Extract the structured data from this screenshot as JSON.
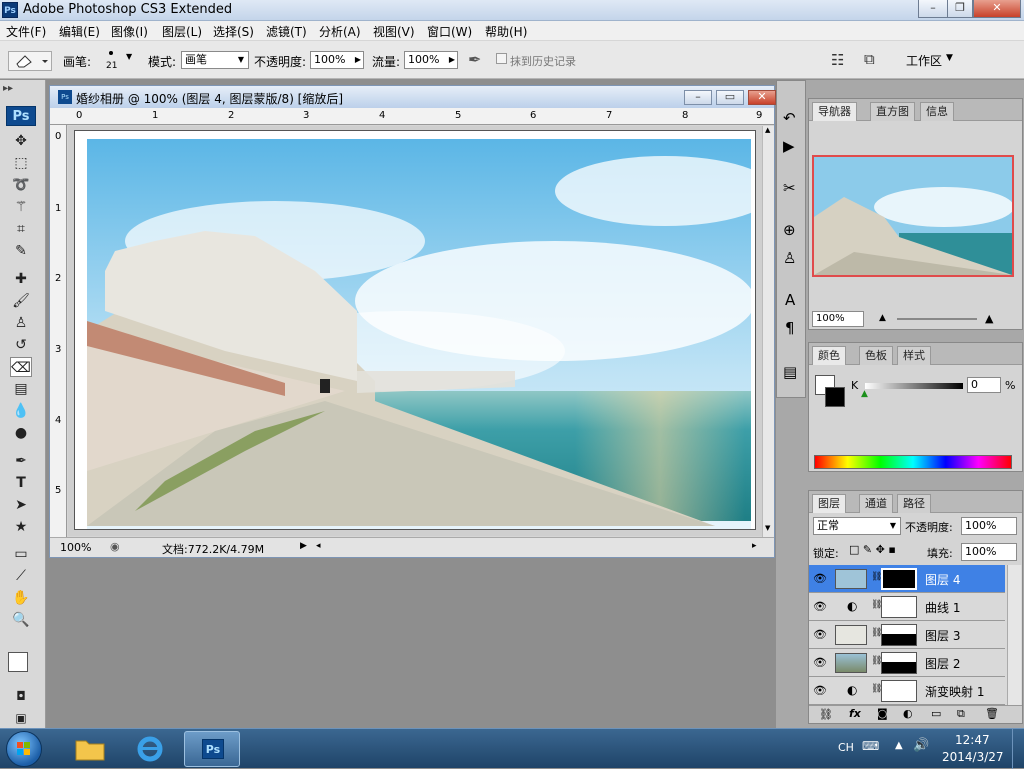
{
  "app": {
    "title": "Adobe Photoshop CS3 Extended",
    "logo": "Ps"
  },
  "window_controls": {
    "minimize": "–",
    "restore": "❐",
    "close": "✕"
  },
  "menu": [
    "文件(F)",
    "编辑(E)",
    "图像(I)",
    "图层(L)",
    "选择(S)",
    "滤镜(T)",
    "分析(A)",
    "视图(V)",
    "窗口(W)",
    "帮助(H)"
  ],
  "options": {
    "brush_label": "画笔:",
    "brush_size": "21",
    "mode_label": "模式:",
    "mode_value": "画笔",
    "opacity_label": "不透明度:",
    "opacity_value": "100%",
    "flow_label": "流量:",
    "flow_value": "100%",
    "history_label": "抹到历史记录",
    "workspace_label": "工作区"
  },
  "document": {
    "title": "婚纱相册 @ 100% (图层 4, 图层蒙版/8) [缩放后]",
    "zoom": "100%",
    "doc_info": "文档:772.2K/4.79M",
    "ruler_h": [
      "0",
      "1",
      "2",
      "3",
      "4",
      "5",
      "6",
      "7",
      "8",
      "9"
    ],
    "ruler_v": [
      "0",
      "1",
      "2",
      "3",
      "4",
      "5"
    ]
  },
  "navigator": {
    "tabs": [
      "导航器",
      "直方图",
      "信息"
    ],
    "zoom": "100%"
  },
  "color": {
    "tabs": [
      "颜色",
      "色板",
      "样式"
    ],
    "channel_label": "K",
    "channel_value": "0",
    "unit": "%"
  },
  "layers": {
    "tabs": [
      "图层",
      "通道",
      "路径"
    ],
    "blend_mode": "正常",
    "opacity_label": "不透明度:",
    "opacity_value": "100%",
    "lock_label": "锁定:",
    "fill_label": "填充:",
    "fill_value": "100%",
    "items": [
      {
        "name": "图层 4",
        "selected": true
      },
      {
        "name": "曲线 1",
        "selected": false
      },
      {
        "name": "图层 3",
        "selected": false
      },
      {
        "name": "图层 2",
        "selected": false
      },
      {
        "name": "渐变映射 1",
        "selected": false
      }
    ]
  },
  "taskbar": {
    "lang": "CH",
    "time": "12:47",
    "date": "2014/3/27",
    "ps_label": "Ps"
  },
  "colors": {
    "selection_blue": "#3f81e5",
    "panel_bg": "#d4d4d4",
    "workspace_gray": "#8e8e8e"
  }
}
